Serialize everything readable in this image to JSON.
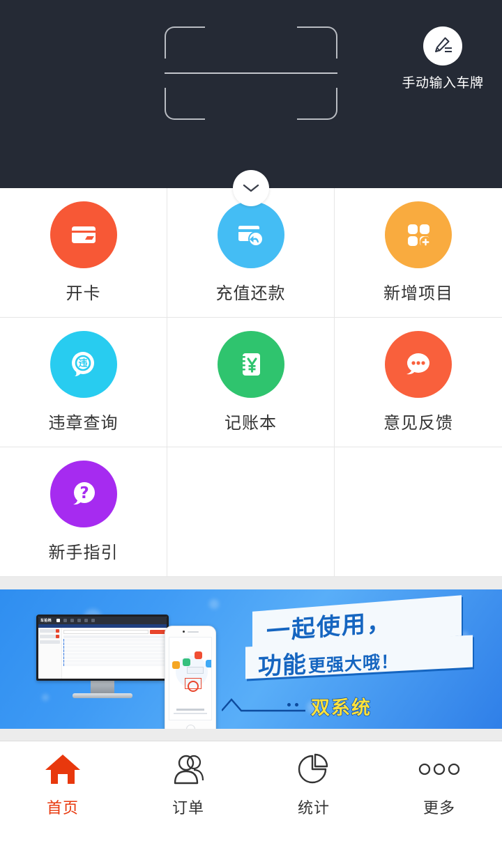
{
  "scanner": {
    "manual_input": {
      "label": "手动输入车牌",
      "icon": "pencil-icon"
    },
    "expand_button_icon": "chevron-down-icon",
    "frame_icon": "license-plate-scan-frame",
    "background_color": "#252a35"
  },
  "grid": {
    "items": [
      {
        "label": "开卡",
        "icon": "card-icon",
        "color": "#f75836"
      },
      {
        "label": "充值还款",
        "icon": "card-refund-icon",
        "color": "#44bdf4"
      },
      {
        "label": "新增项目",
        "icon": "grid-plus-icon",
        "color": "#f9ab3f"
      },
      {
        "label": "违章查询",
        "icon": "violation-search-icon",
        "color": "#28ccf0"
      },
      {
        "label": "记账本",
        "icon": "ledger-yuan-icon",
        "color": "#2fc46e"
      },
      {
        "label": "意见反馈",
        "icon": "chat-dots-icon",
        "color": "#f9603c"
      },
      {
        "label": "新手指引",
        "icon": "question-bubble-icon",
        "color": "#a62bf0"
      }
    ]
  },
  "banner": {
    "line1": "一起使用，",
    "line2_big": "功能",
    "line2_small": "更强大哦！",
    "badge": "双系统",
    "monitor_logo": "车拍档",
    "accent_color": "#1565c0",
    "badge_color": "#ffe23c"
  },
  "tabbar": {
    "items": [
      {
        "label": "首页",
        "icon": "home-icon",
        "active": true
      },
      {
        "label": "订单",
        "icon": "people-icon",
        "active": false
      },
      {
        "label": "统计",
        "icon": "pie-chart-icon",
        "active": false
      },
      {
        "label": "更多",
        "icon": "more-dots-icon",
        "active": false
      }
    ],
    "active_color": "#e8380d",
    "inactive_color": "#333333"
  }
}
